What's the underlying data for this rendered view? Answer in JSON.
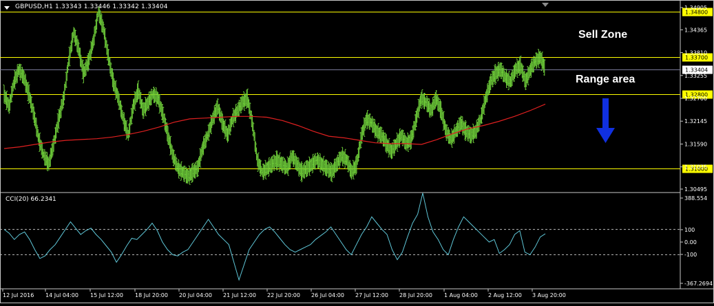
{
  "header": {
    "symbol_text": "GBPUSD,H1  1.33343 1.33446 1.33342 1.33404"
  },
  "annotations": {
    "sell_zone": "Sell Zone",
    "range_area": "Range area"
  },
  "indicator": {
    "label": "CCI(20) 66.2341"
  },
  "colors": {
    "background": "#000000",
    "candles": "#6fcf3a",
    "moving_average": "#e02020",
    "level_lines": "#ffff00",
    "cci_line": "#5fc7d8",
    "arrow": "#1030e0",
    "frame": "#c8c8c8"
  },
  "icons": {
    "chart_menu": "triangle-down-icon",
    "scroll_marker": "triangle-down-icon",
    "arrow": "arrow-down-icon"
  },
  "chart_data": {
    "type": "line",
    "instrument": "GBPUSD",
    "timeframe": "H1",
    "price_axis": {
      "ticks": [
        "1.34905",
        "1.34365",
        "1.33810",
        "1.33255",
        "1.32700",
        "1.32145",
        "1.31590",
        "1.31035",
        "1.30495"
      ],
      "ylim": [
        1.3044,
        1.3496
      ]
    },
    "current_price": {
      "label": "1.33404",
      "value": 1.33404
    },
    "levels": [
      {
        "label": "1.34800",
        "value": 1.348
      },
      {
        "label": "1.33700",
        "value": 1.337
      },
      {
        "label": "1.32800",
        "value": 1.328
      },
      {
        "label": "1.31000",
        "value": 1.31
      }
    ],
    "time_axis": {
      "labels": [
        "12 Jul 2016",
        "14 Jul 04:00",
        "15 Jul 12:00",
        "18 Jul 20:00",
        "20 Jul 04:00",
        "21 Jul 12:00",
        "22 Jul 20:00",
        "26 Jul 04:00",
        "27 Jul 12:00",
        "28 Jul 20:00",
        "1 Aug 04:00",
        "2 Aug 12:00",
        "3 Aug 20:00"
      ]
    },
    "price_series": [
      1.328,
      1.325,
      1.331,
      1.334,
      1.332,
      1.328,
      1.323,
      1.317,
      1.313,
      1.311,
      1.316,
      1.322,
      1.327,
      1.336,
      1.343,
      1.339,
      1.333,
      1.336,
      1.341,
      1.348,
      1.344,
      1.337,
      1.331,
      1.327,
      1.322,
      1.318,
      1.325,
      1.329,
      1.324,
      1.326,
      1.328,
      1.327,
      1.323,
      1.318,
      1.313,
      1.31,
      1.309,
      1.308,
      1.309,
      1.31,
      1.315,
      1.318,
      1.322,
      1.325,
      1.321,
      1.318,
      1.322,
      1.324,
      1.326,
      1.327,
      1.321,
      1.312,
      1.309,
      1.31,
      1.311,
      1.312,
      1.311,
      1.31,
      1.313,
      1.311,
      1.309,
      1.31,
      1.311,
      1.312,
      1.311,
      1.31,
      1.309,
      1.311,
      1.313,
      1.312,
      1.309,
      1.311,
      1.318,
      1.322,
      1.321,
      1.319,
      1.318,
      1.316,
      1.314,
      1.316,
      1.318,
      1.316,
      1.317,
      1.322,
      1.327,
      1.326,
      1.324,
      1.327,
      1.324,
      1.319,
      1.317,
      1.319,
      1.321,
      1.319,
      1.318,
      1.319,
      1.322,
      1.327,
      1.331,
      1.333,
      1.334,
      1.332,
      1.331,
      1.334,
      1.335,
      1.331,
      1.334,
      1.336,
      1.337,
      1.334
    ],
    "ma_series": [
      1.3148,
      1.3152,
      1.3158,
      1.3164,
      1.3168,
      1.317,
      1.3172,
      1.3176,
      1.3182,
      1.319,
      1.32,
      1.3212,
      1.322,
      1.3222,
      1.3224,
      1.3226,
      1.3226,
      1.3224,
      1.3216,
      1.3204,
      1.319,
      1.3178,
      1.3174,
      1.3168,
      1.3162,
      1.316,
      1.316,
      1.3158,
      1.317,
      1.3184,
      1.3196,
      1.3204,
      1.3214,
      1.3226,
      1.324,
      1.3256
    ],
    "cci": {
      "label": "CCI(20) 66.2341",
      "axis_ticks": [
        "388.554",
        "100",
        "0.00",
        "-100",
        "-367.2694"
      ],
      "levels": [
        100,
        -100
      ],
      "ylim": [
        -367.2694,
        388.554
      ],
      "values": [
        100,
        70,
        20,
        60,
        80,
        20,
        -60,
        -130,
        -110,
        -60,
        -20,
        40,
        100,
        160,
        110,
        60,
        90,
        110,
        60,
        20,
        -30,
        -80,
        -160,
        -100,
        -30,
        30,
        20,
        60,
        100,
        150,
        90,
        0,
        -60,
        -100,
        -110,
        -80,
        -60,
        0,
        60,
        120,
        180,
        120,
        60,
        20,
        -20,
        -160,
        -300,
        -180,
        -60,
        0,
        60,
        100,
        120,
        80,
        30,
        -20,
        -60,
        -80,
        -60,
        -40,
        -20,
        20,
        50,
        80,
        120,
        60,
        0,
        -60,
        -100,
        -20,
        60,
        120,
        200,
        150,
        100,
        60,
        -60,
        -140,
        -80,
        40,
        150,
        220,
        388,
        200,
        80,
        20,
        -60,
        -100,
        20,
        120,
        200,
        160,
        120,
        80,
        40,
        0,
        20,
        -90,
        -60,
        -20,
        60,
        90,
        -80,
        -100,
        -40,
        40,
        66
      ]
    }
  }
}
